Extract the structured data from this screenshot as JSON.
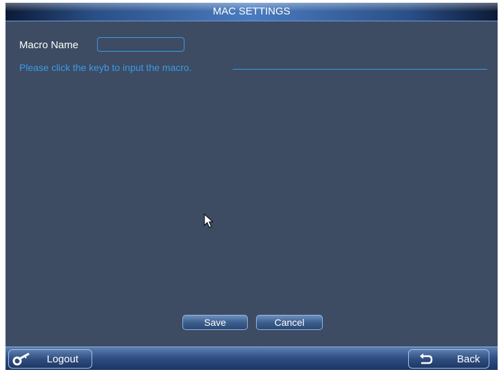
{
  "window": {
    "title": "MAC SETTINGS"
  },
  "form": {
    "macro_name_label": "Macro Name",
    "macro_name_value": "",
    "hint": "Please click the keyb to input the macro."
  },
  "actions": {
    "save_label": "Save",
    "cancel_label": "Cancel"
  },
  "bottom_bar": {
    "logout_label": "Logout",
    "logout_icon": "key-icon",
    "back_label": "Back",
    "back_icon": "return-arrow-icon"
  },
  "colors": {
    "panel_background": "#3d4c63",
    "accent_blue": "#3a9be8",
    "text": "#ffffff"
  }
}
